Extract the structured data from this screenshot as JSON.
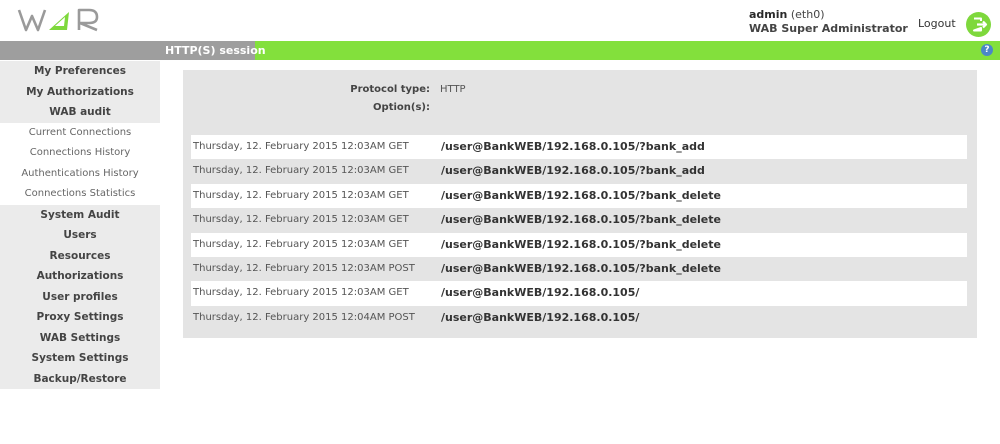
{
  "header": {
    "logo_text": "WAR",
    "user": {
      "name": "admin",
      "iface": "(eth0)",
      "role": "WAB Super Administrator"
    },
    "logout_label": "Logout"
  },
  "titlebar": {
    "title": "HTTP(S) session",
    "help_glyph": "?"
  },
  "sidebar": {
    "items": [
      {
        "label": "My Preferences",
        "kind": "main"
      },
      {
        "label": "My Authorizations",
        "kind": "main"
      },
      {
        "label": "WAB audit",
        "kind": "main"
      },
      {
        "label": "Current Connections",
        "kind": "sub"
      },
      {
        "label": "Connections History",
        "kind": "sub"
      },
      {
        "label": "Authentications History",
        "kind": "sub"
      },
      {
        "label": "Connections Statistics",
        "kind": "sub"
      },
      {
        "label": "System Audit",
        "kind": "main"
      },
      {
        "label": "Users",
        "kind": "main"
      },
      {
        "label": "Resources",
        "kind": "main"
      },
      {
        "label": "Authorizations",
        "kind": "main"
      },
      {
        "label": "User profiles",
        "kind": "main"
      },
      {
        "label": "Proxy Settings",
        "kind": "main"
      },
      {
        "label": "WAB Settings",
        "kind": "main"
      },
      {
        "label": "System Settings",
        "kind": "main"
      },
      {
        "label": "Backup/Restore",
        "kind": "main"
      }
    ]
  },
  "session": {
    "protocol_label": "Protocol type:",
    "protocol_value": "HTTP",
    "options_label": "Option(s):",
    "options_value": ""
  },
  "log": [
    {
      "date": "Thursday, 12. February 2015 12:03AM",
      "method": "GET",
      "url": "/user@BankWEB/192.168.0.105/?bank_add"
    },
    {
      "date": "Thursday, 12. February 2015 12:03AM",
      "method": "GET",
      "url": "/user@BankWEB/192.168.0.105/?bank_add"
    },
    {
      "date": "Thursday, 12. February 2015 12:03AM",
      "method": "GET",
      "url": "/user@BankWEB/192.168.0.105/?bank_delete"
    },
    {
      "date": "Thursday, 12. February 2015 12:03AM",
      "method": "GET",
      "url": "/user@BankWEB/192.168.0.105/?bank_delete"
    },
    {
      "date": "Thursday, 12. February 2015 12:03AM",
      "method": "GET",
      "url": "/user@BankWEB/192.168.0.105/?bank_delete"
    },
    {
      "date": "Thursday, 12. February 2015 12:03AM",
      "method": "POST",
      "url": "/user@BankWEB/192.168.0.105/?bank_delete"
    },
    {
      "date": "Thursday, 12. February 2015 12:03AM",
      "method": "GET",
      "url": "/user@BankWEB/192.168.0.105/"
    },
    {
      "date": "Thursday, 12. February 2015 12:04AM",
      "method": "POST",
      "url": "/user@BankWEB/192.168.0.105/"
    }
  ],
  "colors": {
    "accent_green": "#83e03c",
    "logo_green": "#7ed83c",
    "logo_grey": "#9a9a9a",
    "panel_grey": "#e4e4e4",
    "help_blue": "#4b87c7"
  },
  "icons": {
    "logo": "logo-icon",
    "logout": "exit-door-icon",
    "help": "question-mark-icon"
  }
}
